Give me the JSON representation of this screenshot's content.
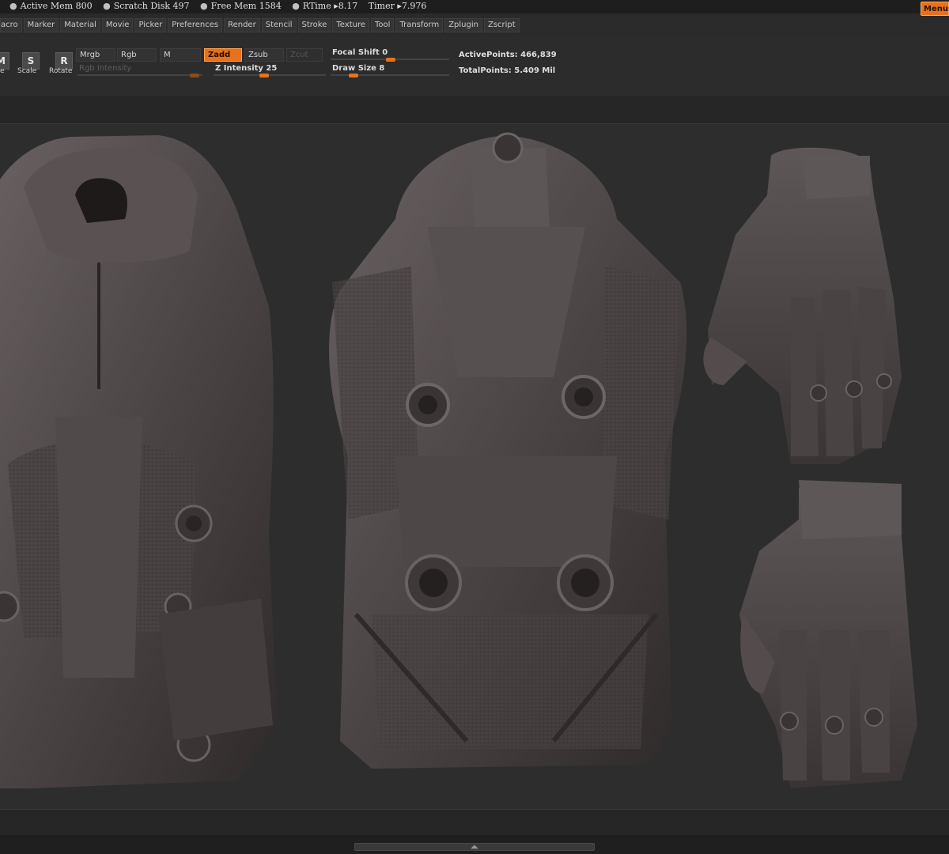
{
  "status": {
    "items": [
      {
        "label": "Active Mem",
        "value": "800"
      },
      {
        "label": "Scratch Disk",
        "value": "497"
      },
      {
        "label": "Free Mem",
        "value": "1584"
      },
      {
        "label": "RTime",
        "value": "8.17"
      },
      {
        "label": "Timer",
        "value": "7.976"
      }
    ],
    "menus_label": "Menus"
  },
  "menu": [
    "acro",
    "Marker",
    "Material",
    "Movie",
    "Picker",
    "Preferences",
    "Render",
    "Stencil",
    "Stroke",
    "Texture",
    "Tool",
    "Transform",
    "Zplugin",
    "Zscript"
  ],
  "toolbar": {
    "icons": [
      {
        "glyph": "M",
        "label": "e"
      },
      {
        "glyph": "S",
        "label": "Scale"
      },
      {
        "glyph": "R",
        "label": "Rotate"
      }
    ],
    "mrgb": "Mrgb",
    "rgb": "Rgb",
    "m": "M",
    "zadd": "Zadd",
    "zsub": "Zsub",
    "zcut": "Zcut",
    "rgb_intensity": "Rgb Intensity",
    "z_intensity_label": "Z Intensity",
    "z_intensity_value": "25",
    "focal_shift_label": "Focal Shift",
    "focal_shift_value": "0",
    "draw_size_label": "Draw Size",
    "draw_size_value": "8",
    "active_points_label": "ActivePoints:",
    "active_points_value": "466,839",
    "total_points_label": "TotalPoints:",
    "total_points_value": "5.409 Mil"
  },
  "colors": {
    "accent": "#e8721c",
    "model": "#4a4444",
    "background": "#2d2d2d"
  },
  "bottom": {
    "handle_glyph": "◢◣"
  }
}
